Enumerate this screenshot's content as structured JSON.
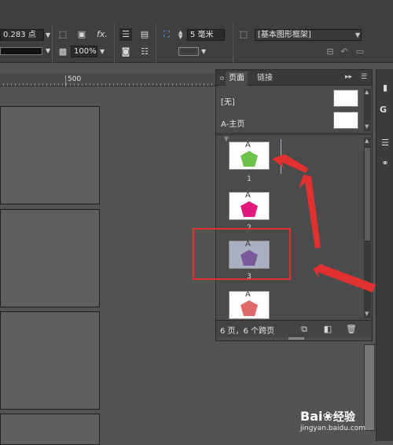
{
  "toolbar": {
    "stroke_weight": "0.283 点",
    "opacity": "100%",
    "spacing": "5 毫米",
    "object_style": "[基本图形框架]",
    "fx_label": "fx."
  },
  "ruler": {
    "mark": "500"
  },
  "pages_panel": {
    "tab_pages": "页面",
    "tab_links": "链接",
    "masters": [
      {
        "label": "[无]"
      },
      {
        "label": "A-主页"
      }
    ],
    "pages": [
      {
        "master_prefix": "A",
        "number": "1",
        "color": "#6cc24a"
      },
      {
        "master_prefix": "A",
        "number": "2",
        "color": "#e0197d"
      },
      {
        "master_prefix": "A",
        "number": "3",
        "color": "#7a5a9a",
        "selected": true
      },
      {
        "master_prefix": "A",
        "number": "",
        "color": "#e06a6a"
      }
    ],
    "status": "6 页，6 个跨页"
  },
  "right_strip": {
    "letter": "G"
  },
  "watermark": {
    "brand": "Bai",
    "brand_cn": "经验",
    "url": "jingyan.baidu.com"
  },
  "colors": {
    "annotation_red": "#e03030",
    "selection_blue": "#5b8ed6"
  }
}
